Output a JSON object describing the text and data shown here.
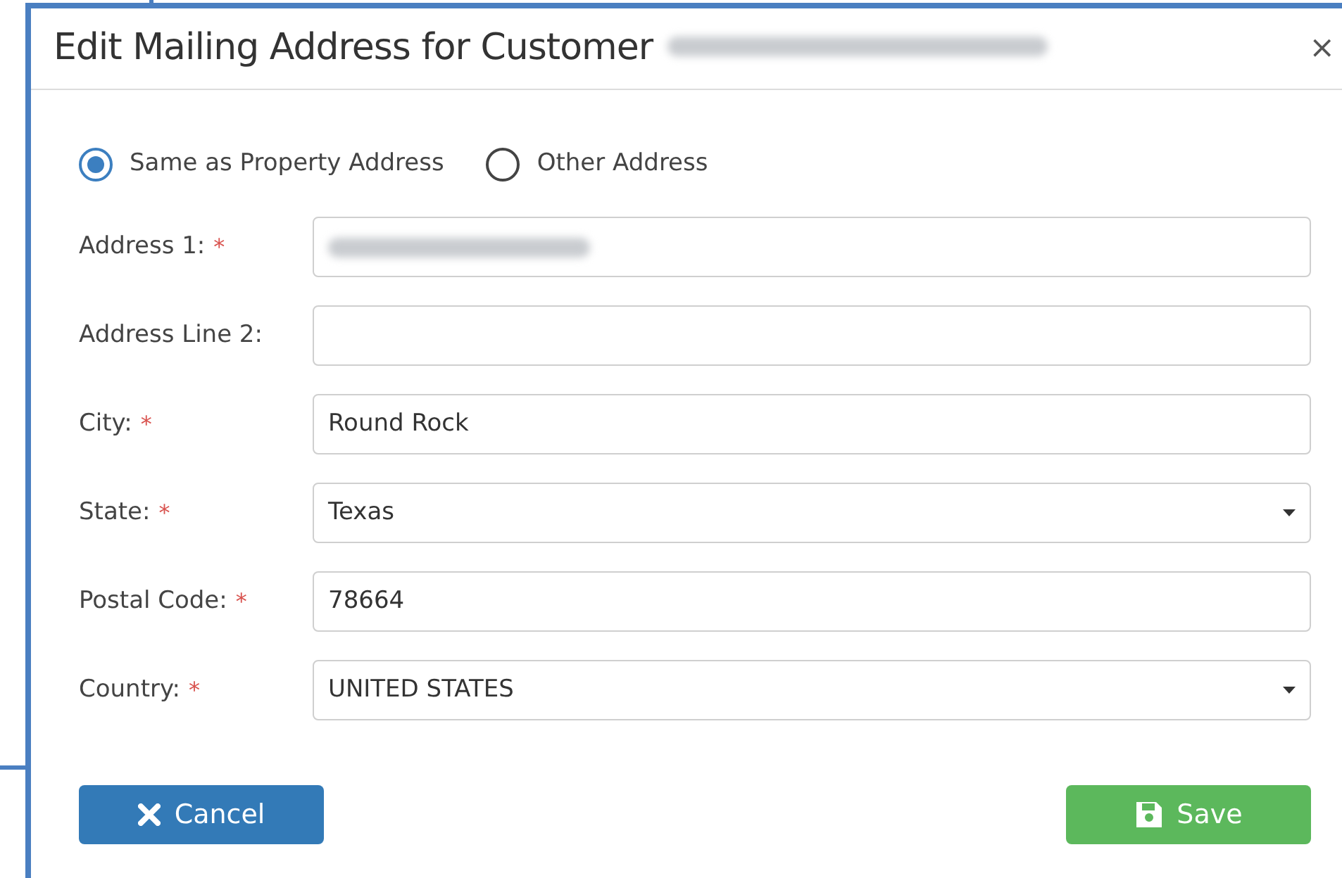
{
  "dialog": {
    "title": "Edit Mailing Address for Customer",
    "title_redacted": true,
    "close": "×"
  },
  "address_options": [
    {
      "label": "Same as Property Address",
      "selected": true
    },
    {
      "label": "Other Address",
      "selected": false
    }
  ],
  "fields": [
    {
      "label": "Address 1:",
      "required": true,
      "kind": "text",
      "redacted": true
    },
    {
      "label": "Address Line 2:",
      "required": false,
      "kind": "text"
    },
    {
      "label": "City:",
      "required": true,
      "kind": "text",
      "value": "Round Rock"
    },
    {
      "label": "State:",
      "required": true,
      "kind": "select",
      "value": "Texas"
    },
    {
      "label": "Postal Code:",
      "required": true,
      "kind": "text",
      "value": "78664"
    },
    {
      "label": "Country:",
      "required": true,
      "kind": "select",
      "value": "UNITED STATES"
    }
  ],
  "required_mark": "*",
  "buttons": [
    {
      "label": "Cancel",
      "kind": "cancel"
    },
    {
      "label": "Save",
      "kind": "save"
    }
  ]
}
